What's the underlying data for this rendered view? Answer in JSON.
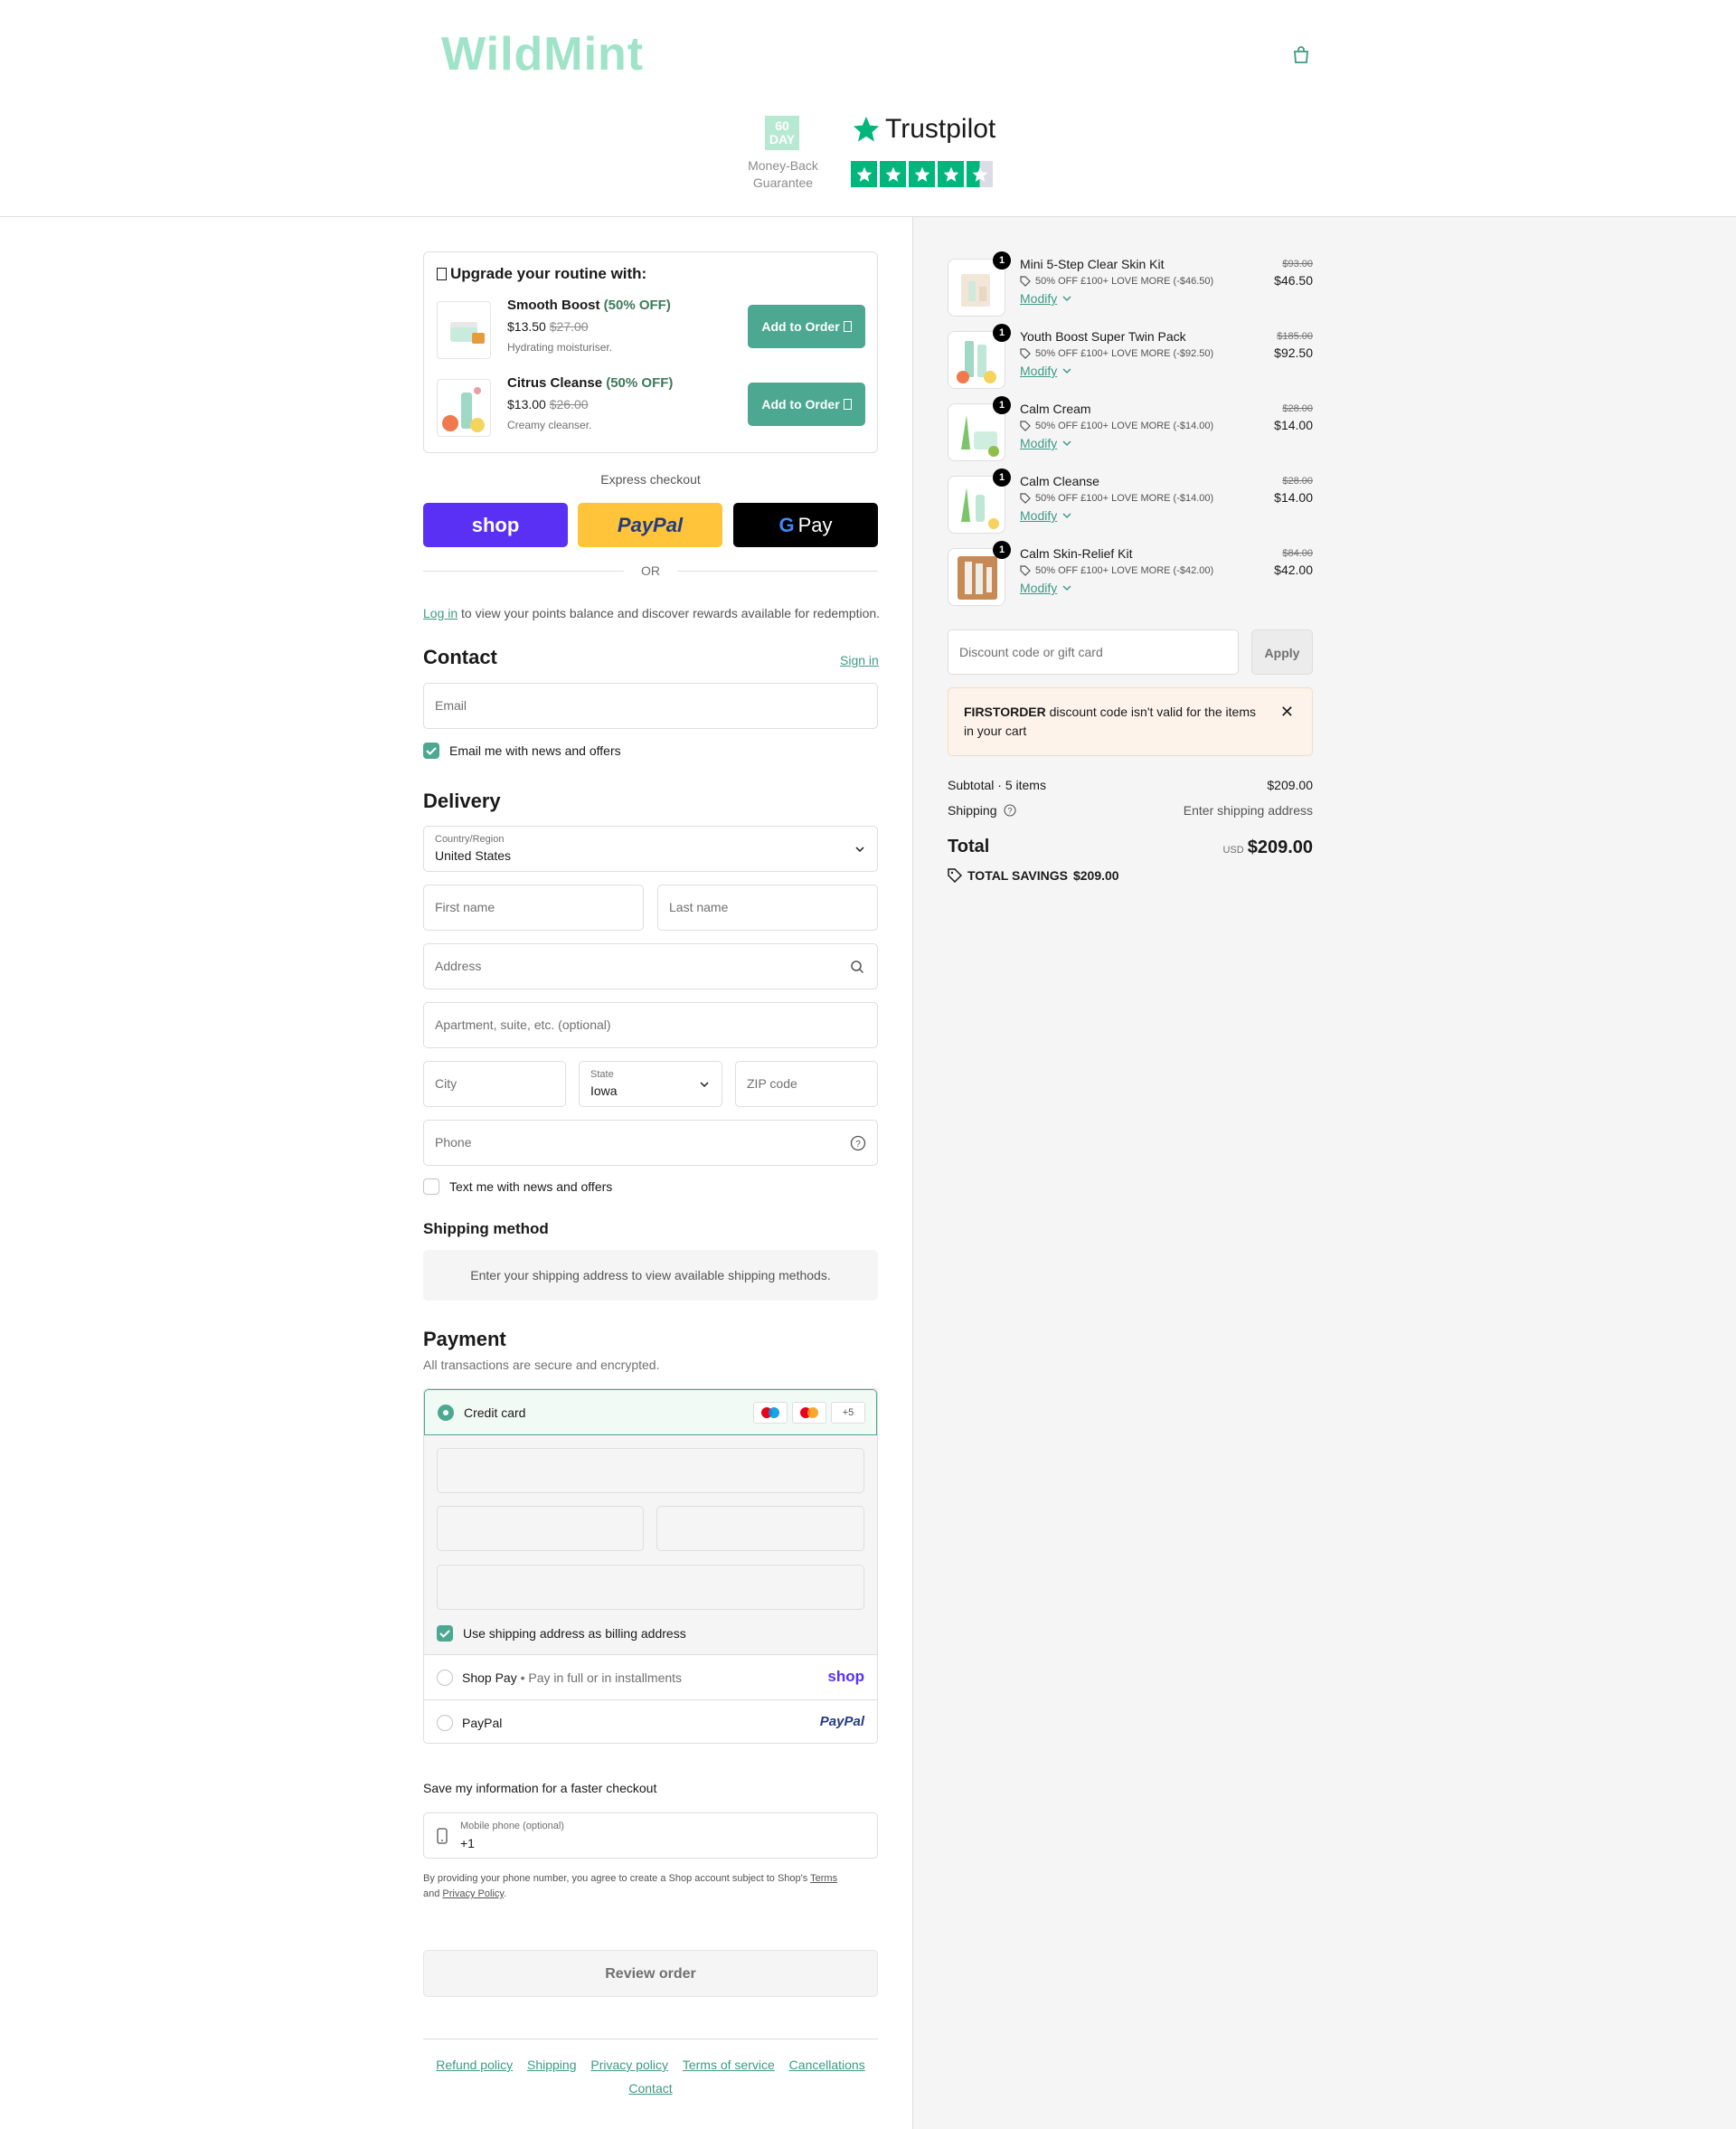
{
  "header": {
    "logo": "WildMint",
    "guarantee_badge": "60 DAY",
    "guarantee_text": "Money-Back Guarantee",
    "trustpilot": "Trustpilot",
    "trustpilot_rating_stars": 4.5,
    "cart_icon": "shopping-bag-icon"
  },
  "upsell": {
    "title": "Upgrade your routine with:",
    "items": [
      {
        "name": "Smooth Boost",
        "off": "(50% OFF)",
        "price": "$13.50",
        "old_price": "$27.00",
        "desc": "Hydrating moisturiser.",
        "button": "Add to Order"
      },
      {
        "name": "Citrus Cleanse",
        "off": "(50% OFF)",
        "price": "$13.00",
        "old_price": "$26.00",
        "desc": "Creamy cleanser.",
        "button": "Add to Order"
      }
    ]
  },
  "express": {
    "label": "Express checkout",
    "shop": "shop",
    "paypal": "PayPal",
    "gpay": "Pay",
    "or": "OR"
  },
  "login": {
    "link": "Log in",
    "text": " to view your points balance and discover rewards available for redemption."
  },
  "contact": {
    "title": "Contact",
    "sign_in": "Sign in",
    "email_placeholder": "Email",
    "news_label": "Email me with news and offers",
    "news_checked": true
  },
  "delivery": {
    "title": "Delivery",
    "country_label": "Country/Region",
    "country_value": "United States",
    "first_name": "First name",
    "last_name": "Last name",
    "address": "Address",
    "apartment": "Apartment, suite, etc. (optional)",
    "city": "City",
    "state_label": "State",
    "state_value": "Iowa",
    "zip": "ZIP code",
    "phone": "Phone",
    "text_label": "Text me with news and offers",
    "text_checked": false
  },
  "shipping_method": {
    "title": "Shipping method",
    "message": "Enter your shipping address to view available shipping methods."
  },
  "payment": {
    "title": "Payment",
    "subtitle": "All transactions are secure and encrypted.",
    "credit_card": "Credit card",
    "more_cards": "+5",
    "billing_label": "Use shipping address as billing address",
    "shop_pay": "Shop Pay",
    "shop_pay_sub": "Pay in full or in installments",
    "shop_logo": "shop",
    "paypal": "PayPal",
    "paypal_logo": "PayPal"
  },
  "save_info": {
    "title": "Save my information for a faster checkout",
    "mobile_label": "Mobile phone (optional)",
    "mobile_value": "+1",
    "terms_pre": "By providing your phone number, you agree to create a Shop account subject to Shop's ",
    "terms_link": "Terms",
    "terms_mid": "and ",
    "privacy_link": "Privacy Policy",
    "terms_end": "."
  },
  "review_button": "Review order",
  "footer": {
    "links": [
      "Refund policy",
      "Shipping",
      "Privacy policy",
      "Terms of service",
      "Cancellations",
      "Contact"
    ]
  },
  "summary": {
    "items": [
      {
        "qty": "1",
        "name": "Mini 5-Step Clear Skin Kit",
        "discount": "50% OFF £100+ LOVE MORE (-$46.50)",
        "modify": "Modify",
        "old_price": "$93.00",
        "price": "$46.50"
      },
      {
        "qty": "1",
        "name": "Youth Boost Super Twin Pack",
        "discount": "50% OFF £100+ LOVE MORE (-$92.50)",
        "modify": "Modify",
        "old_price": "$185.00",
        "price": "$92.50"
      },
      {
        "qty": "1",
        "name": "Calm Cream",
        "discount": "50% OFF £100+ LOVE MORE (-$14.00)",
        "modify": "Modify",
        "old_price": "$28.00",
        "price": "$14.00"
      },
      {
        "qty": "1",
        "name": "Calm Cleanse",
        "discount": "50% OFF £100+ LOVE MORE (-$14.00)",
        "modify": "Modify",
        "old_price": "$28.00",
        "price": "$14.00"
      },
      {
        "qty": "1",
        "name": "Calm Skin-Relief Kit",
        "discount": "50% OFF £100+ LOVE MORE (-$42.00)",
        "modify": "Modify",
        "old_price": "$84.00",
        "price": "$42.00"
      }
    ],
    "discount_placeholder": "Discount code or gift card",
    "apply": "Apply",
    "warning_code": "FIRSTORDER",
    "warning_text": " discount code isn't valid for the items in your cart",
    "subtotal_label": "Subtotal · 5 items",
    "subtotal_value": "$209.00",
    "shipping_label": "Shipping",
    "shipping_value": "Enter shipping address",
    "total_label": "Total",
    "total_currency": "USD",
    "total_value": "$209.00",
    "savings_label": "TOTAL SAVINGS",
    "savings_value": "$209.00"
  },
  "colors": {
    "accent": "#4da892",
    "link": "#3d9a82",
    "shop_purple": "#5a31f4",
    "paypal_yellow": "#ffc439",
    "trustpilot_green": "#00b67a",
    "logo_mint": "#9fe3c9"
  }
}
